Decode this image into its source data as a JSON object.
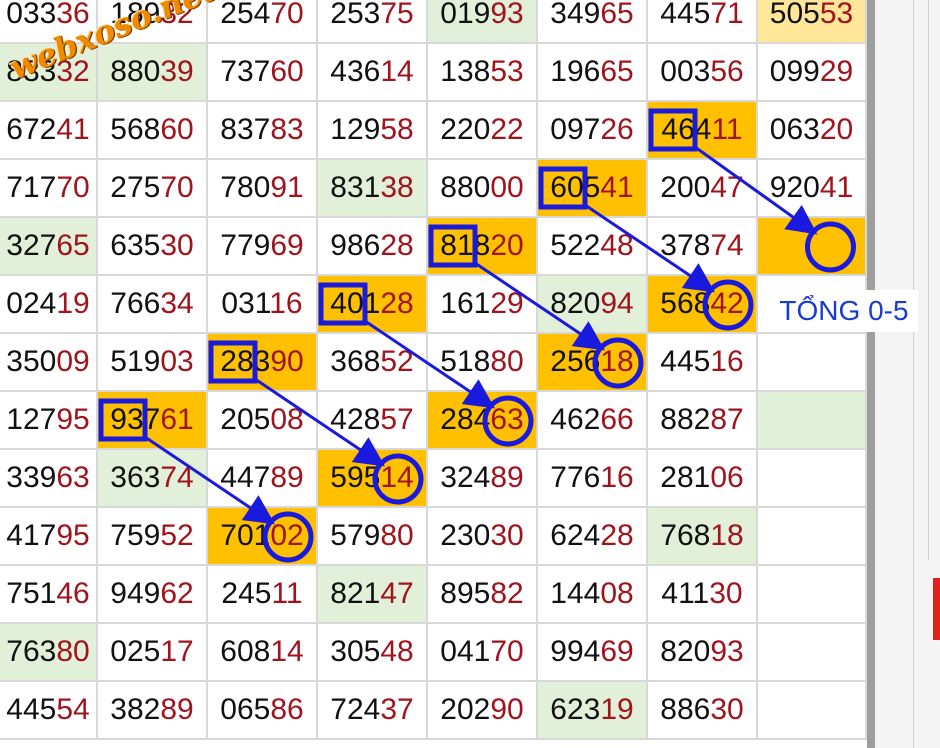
{
  "watermark": "webxoso.net",
  "sum_label": "TỔNG 0-5",
  "colors": {
    "digit_text": "#111111",
    "tail_digits": "#a0141e",
    "highlight_orange": "#ffc000",
    "highlight_green": "#e2f0d9",
    "highlight_cream": "#ffe699",
    "arrow_blue": "#1a1adf",
    "label_blue": "#1a3ad6",
    "watermark_orange": "#f08a00"
  },
  "grid": {
    "rows": [
      [
        [
          "033",
          "36"
        ],
        [
          "189",
          "32"
        ],
        [
          "254",
          "70"
        ],
        [
          "253",
          "75"
        ],
        [
          "019",
          "93"
        ],
        [
          "349",
          "65"
        ],
        [
          "445",
          "71"
        ],
        [
          "505",
          "53"
        ]
      ],
      [
        [
          "833",
          "32"
        ],
        [
          "880",
          "39"
        ],
        [
          "737",
          "60"
        ],
        [
          "436",
          "14"
        ],
        [
          "138",
          "53"
        ],
        [
          "196",
          "65"
        ],
        [
          "003",
          "56"
        ],
        [
          "099",
          "29"
        ]
      ],
      [
        [
          "672",
          "41"
        ],
        [
          "568",
          "60"
        ],
        [
          "837",
          "83"
        ],
        [
          "129",
          "58"
        ],
        [
          "220",
          "22"
        ],
        [
          "097",
          "26"
        ],
        [
          "464",
          "11"
        ],
        [
          "063",
          "20"
        ]
      ],
      [
        [
          "717",
          "70"
        ],
        [
          "275",
          "70"
        ],
        [
          "780",
          "91"
        ],
        [
          "831",
          "38"
        ],
        [
          "880",
          "00"
        ],
        [
          "605",
          "41"
        ],
        [
          "200",
          "47"
        ],
        [
          "920",
          "41"
        ]
      ],
      [
        [
          "327",
          "65"
        ],
        [
          "635",
          "30"
        ],
        [
          "779",
          "69"
        ],
        [
          "986",
          "28"
        ],
        [
          "818",
          "20"
        ],
        [
          "522",
          "48"
        ],
        [
          "378",
          "74"
        ],
        [
          "",
          ""
        ]
      ],
      [
        [
          "024",
          "19"
        ],
        [
          "766",
          "34"
        ],
        [
          "031",
          "16"
        ],
        [
          "401",
          "28"
        ],
        [
          "161",
          "29"
        ],
        [
          "820",
          "94"
        ],
        [
          "568",
          "42"
        ],
        [
          "",
          ""
        ]
      ],
      [
        [
          "350",
          "09"
        ],
        [
          "519",
          "03"
        ],
        [
          "283",
          "90"
        ],
        [
          "368",
          "52"
        ],
        [
          "518",
          "80"
        ],
        [
          "256",
          "18"
        ],
        [
          "445",
          "16"
        ],
        [
          "",
          ""
        ]
      ],
      [
        [
          "127",
          "95"
        ],
        [
          "937",
          "61"
        ],
        [
          "205",
          "08"
        ],
        [
          "428",
          "57"
        ],
        [
          "284",
          "63"
        ],
        [
          "462",
          "66"
        ],
        [
          "882",
          "87"
        ],
        [
          "",
          ""
        ]
      ],
      [
        [
          "339",
          "63"
        ],
        [
          "363",
          "74"
        ],
        [
          "447",
          "89"
        ],
        [
          "595",
          "14"
        ],
        [
          "324",
          "89"
        ],
        [
          "776",
          "16"
        ],
        [
          "281",
          "06"
        ],
        [
          "",
          ""
        ]
      ],
      [
        [
          "417",
          "95"
        ],
        [
          "759",
          "52"
        ],
        [
          "701",
          "02"
        ],
        [
          "579",
          "80"
        ],
        [
          "230",
          "30"
        ],
        [
          "624",
          "28"
        ],
        [
          "768",
          "18"
        ],
        [
          "",
          ""
        ]
      ],
      [
        [
          "751",
          "46"
        ],
        [
          "949",
          "62"
        ],
        [
          "245",
          "11"
        ],
        [
          "821",
          "47"
        ],
        [
          "895",
          "82"
        ],
        [
          "144",
          "08"
        ],
        [
          "411",
          "30"
        ],
        [
          "",
          ""
        ]
      ],
      [
        [
          "763",
          "80"
        ],
        [
          "025",
          "17"
        ],
        [
          "608",
          "14"
        ],
        [
          "305",
          "48"
        ],
        [
          "041",
          "70"
        ],
        [
          "994",
          "69"
        ],
        [
          "820",
          "93"
        ],
        [
          "",
          ""
        ]
      ],
      [
        [
          "445",
          "54"
        ],
        [
          "382",
          "89"
        ],
        [
          "065",
          "86"
        ],
        [
          "724",
          "37"
        ],
        [
          "202",
          "90"
        ],
        [
          "623",
          "19"
        ],
        [
          "886",
          "30"
        ],
        [
          "",
          ""
        ]
      ]
    ],
    "highlights": {
      "0-4": "green",
      "0-7": "cream",
      "1-0": "green",
      "1-1": "green",
      "2-6": "orange",
      "3-3": "green",
      "3-5": "orange",
      "4-0": "green",
      "4-4": "orange",
      "4-7": "orange",
      "5-3": "orange",
      "5-5": "green",
      "5-6": "orange",
      "6-2": "orange",
      "6-5": "orange",
      "7-1": "orange",
      "7-4": "orange",
      "7-7": "green",
      "8-1": "green",
      "8-3": "orange",
      "9-2": "orange",
      "9-6": "green",
      "10-3": "green",
      "11-0": "green",
      "12-5": "green"
    }
  },
  "markers": {
    "boxes": [
      [
        7,
        1
      ],
      [
        6,
        2
      ],
      [
        5,
        3
      ],
      [
        4,
        4
      ],
      [
        3,
        5
      ],
      [
        2,
        6
      ]
    ],
    "circles": [
      [
        9,
        2
      ],
      [
        8,
        3
      ],
      [
        7,
        4
      ],
      [
        6,
        5
      ],
      [
        5,
        6
      ],
      [
        4,
        7
      ]
    ]
  }
}
